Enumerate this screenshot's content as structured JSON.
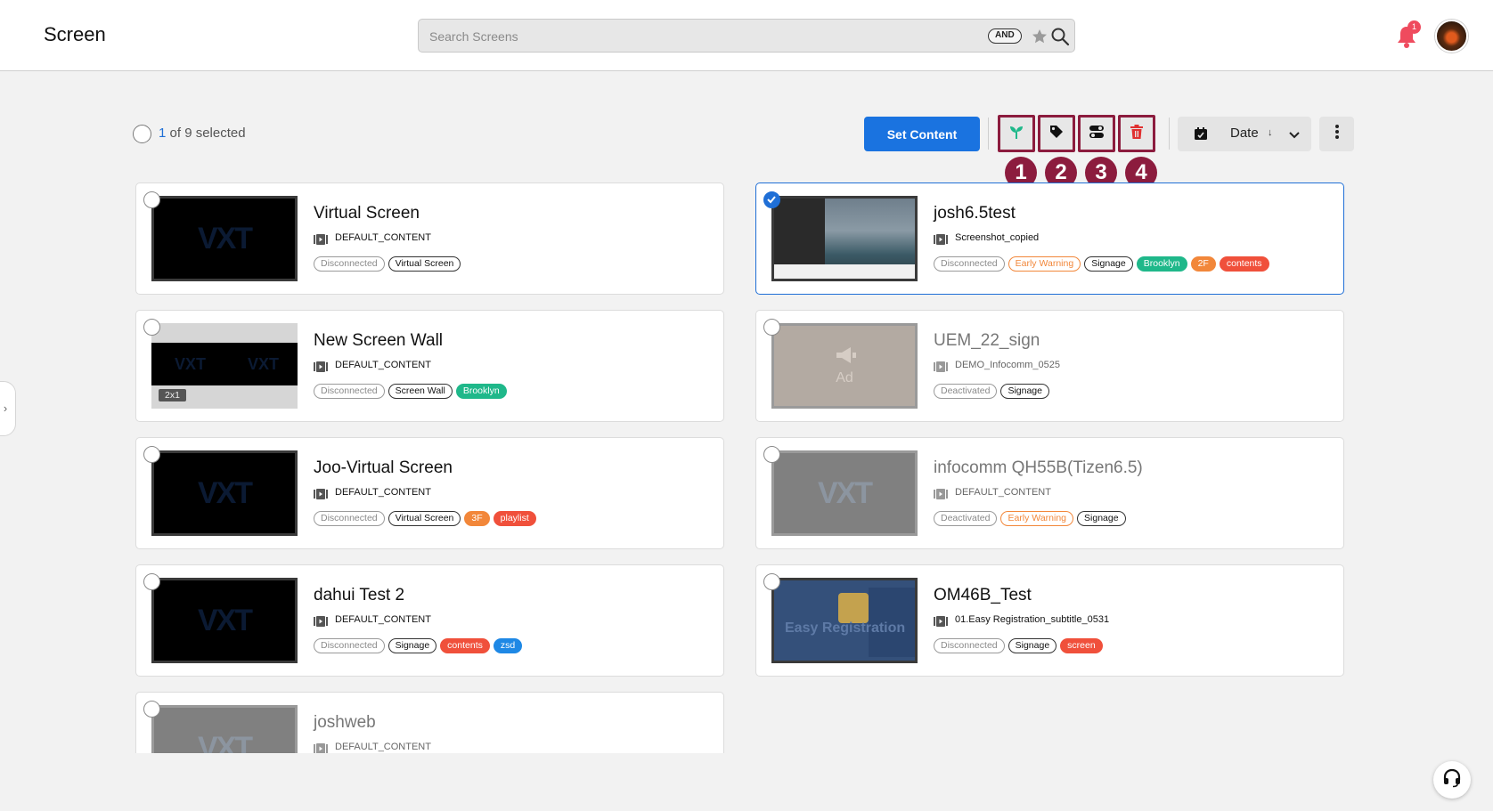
{
  "header": {
    "title": "Screen",
    "search_placeholder": "Search Screens",
    "search_mode": "AND",
    "notification_count": "1",
    "icons": [
      "star-icon",
      "search-icon",
      "bell-icon",
      "avatar"
    ]
  },
  "toolbar": {
    "selected_num": "1",
    "selected_suffix": " of 9 selected",
    "set_content_label": "Set Content",
    "tools": [
      {
        "icon": "sprout-icon",
        "callout": "1"
      },
      {
        "icon": "tag-icon",
        "callout": "2"
      },
      {
        "icon": "toggle-icon",
        "callout": "3"
      },
      {
        "icon": "trash-icon",
        "callout": "4"
      }
    ],
    "sort_label": "Date",
    "sort_direction": "↓",
    "colors": {
      "accent": "#1a73e0",
      "callout": "#8c1c3e",
      "trash": "#e03030",
      "sprout": "#1fb88a"
    }
  },
  "screens": [
    {
      "name": "Virtual Screen",
      "content": "DEFAULT_CONTENT",
      "tags": [
        "Disconnected",
        "Virtual Screen"
      ]
    },
    {
      "name": "josh6.5test",
      "content": "Screenshot_copied",
      "tags": [
        "Disconnected",
        "Early Warning",
        "Signage",
        "Brooklyn",
        "2F",
        "contents"
      ],
      "selected": true
    },
    {
      "name": "New Screen Wall",
      "content": "DEFAULT_CONTENT",
      "tags": [
        "Disconnected",
        "Screen Wall",
        "Brooklyn"
      ],
      "wall_size": "2x1"
    },
    {
      "name": "UEM_22_sign",
      "content": "DEMO_Infocomm_0525",
      "tags": [
        "Deactivated",
        "Signage"
      ],
      "thumb_text": "Ad"
    },
    {
      "name": "Joo-Virtual Screen",
      "content": "DEFAULT_CONTENT",
      "tags": [
        "Disconnected",
        "Virtual Screen",
        "3F",
        "playlist"
      ]
    },
    {
      "name": "infocomm QH55B(Tizen6.5)",
      "content": "DEFAULT_CONTENT",
      "tags": [
        "Deactivated",
        "Early Warning",
        "Signage"
      ]
    },
    {
      "name": "dahui Test 2",
      "content": "DEFAULT_CONTENT",
      "tags": [
        "Disconnected",
        "Signage",
        "contents",
        "zsd"
      ]
    },
    {
      "name": "OM46B_Test",
      "content": "01.Easy Registration_subtitle_0531",
      "tags": [
        "Disconnected",
        "Signage",
        "screen"
      ],
      "thumb_text": "Easy Registration"
    },
    {
      "name": "joshweb",
      "content": "DEFAULT_CONTENT",
      "tags": []
    }
  ],
  "thumb_logo": "VXT",
  "side_toggle": "›"
}
